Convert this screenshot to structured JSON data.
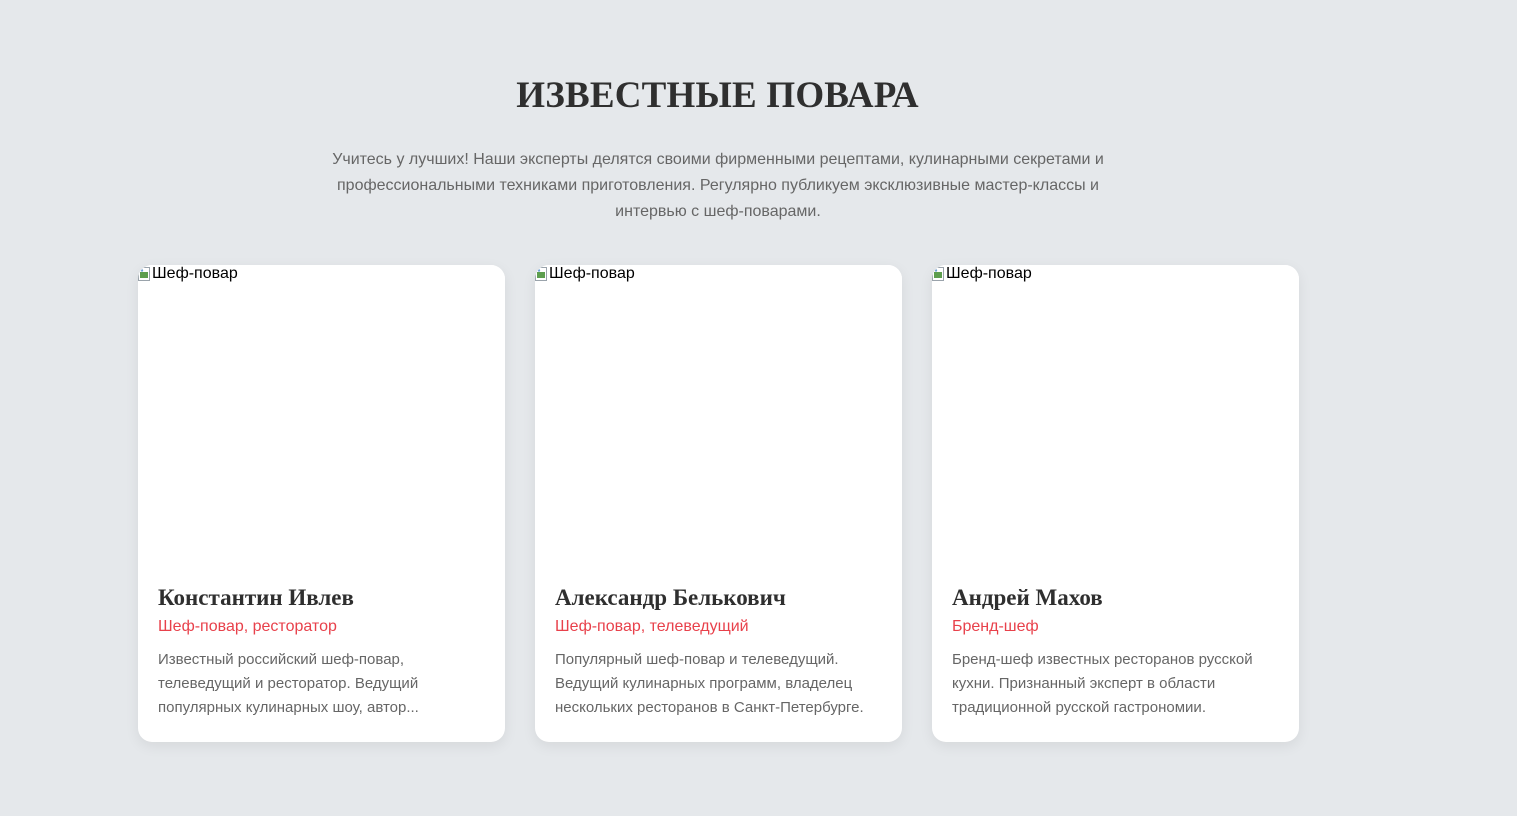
{
  "section": {
    "title": "ИЗВЕСТНЫЕ ПОВАРА",
    "description": "Учитесь у лучших! Наши эксперты делятся своими фирменными рецептами, кулинарными секретами и профессиональными техниками приготовления. Регулярно публикуем эксклюзивные мастер-классы и интервью с шеф-поварами."
  },
  "colors": {
    "background": "#e5e8eb",
    "card": "#ffffff",
    "accent": "#e8414b",
    "heading": "#2f2f2f",
    "muted_text": "#666666"
  },
  "chefs": [
    {
      "image_alt": "Шеф-повар",
      "name": "Константин Ивлев",
      "role": "Шеф-повар, ресторатор",
      "bio": "Известный российский шеф-повар, телеведущий и ресторатор. Ведущий популярных кулинарных шоу, автор..."
    },
    {
      "image_alt": "Шеф-повар",
      "name": "Александр Белькович",
      "role": "Шеф-повар, телеведущий",
      "bio": "Популярный шеф-повар и телеведущий. Ведущий кулинарных программ, владелец нескольких ресторанов в Санкт-Петербурге."
    },
    {
      "image_alt": "Шеф-повар",
      "name": "Андрей Махов",
      "role": "Бренд-шеф",
      "bio": "Бренд-шеф известных ресторанов русской кухни. Признанный эксперт в области традиционной русской гастрономии."
    }
  ],
  "icons": {
    "broken_image": "broken-image-icon"
  }
}
